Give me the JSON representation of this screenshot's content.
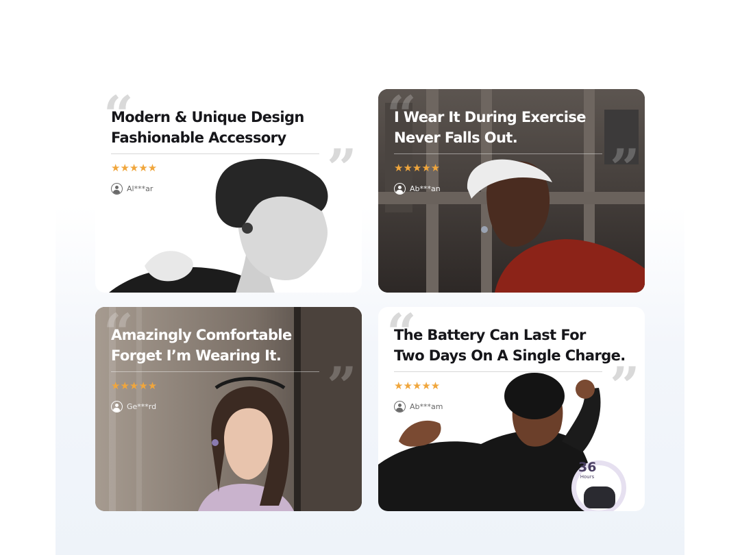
{
  "reviews": [
    {
      "title_line1": "Modern & Unique Design",
      "title_line2": "Fashionable Accessory",
      "stars": "★★★★★",
      "rating": 5,
      "reviewer": "Al***ar"
    },
    {
      "title_line1": "I Wear It During Exercise",
      "title_line2": "Never Falls Out.",
      "stars": "★★★★★",
      "rating": 5,
      "reviewer": "Ab***an"
    },
    {
      "title_line1": "Amazingly Comfortable",
      "title_line2": "Forget I’m Wearing It.",
      "stars": "★★★★★",
      "rating": 5,
      "reviewer": "Ge***rd"
    },
    {
      "title_line1": "The Battery Can Last For",
      "title_line2": "Two Days On A Single Charge.",
      "stars": "★★★★★",
      "rating": 5,
      "reviewer": "Ab***am"
    }
  ],
  "battery_badge": {
    "number": "36",
    "unit": "Hours"
  },
  "icons": {
    "open_quote": "“",
    "close_quote": "”",
    "star": "star-icon",
    "user": "user-icon"
  },
  "colors": {
    "star": "#f0a63c",
    "badge": "#4a3f63",
    "panel_background": "#eef3f9"
  }
}
